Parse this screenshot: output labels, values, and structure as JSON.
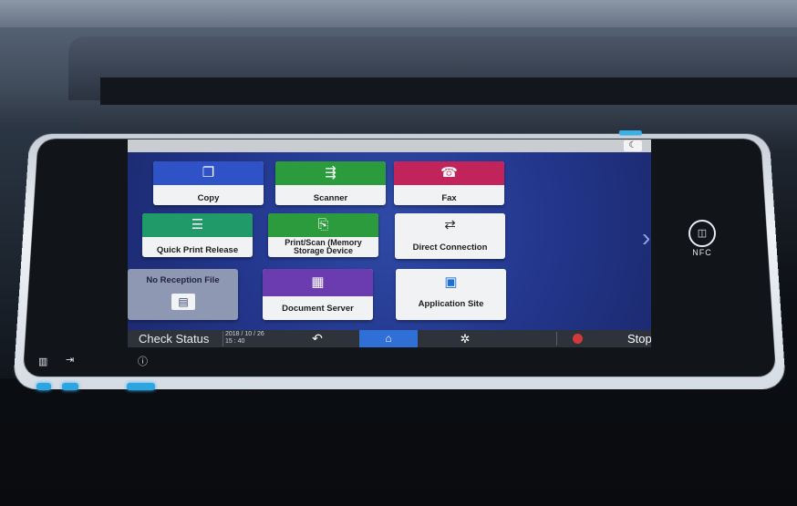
{
  "screen": {
    "tiles": [
      {
        "label": "Copy",
        "color": "#2f52c6",
        "icon": "copy-icon"
      },
      {
        "label": "Scanner",
        "color": "#2c9b3d",
        "icon": "scanner-icon"
      },
      {
        "label": "Fax",
        "color": "#c0245a",
        "icon": "fax-icon"
      },
      {
        "label": "Quick Print Release",
        "color": "#1f9a68",
        "icon": "quick-print-icon"
      },
      {
        "label": "Print/Scan (Memory Storage Device",
        "color": "#2c9b3d",
        "icon": "usb-sd-icon"
      },
      {
        "label": "Direct Connection",
        "icon": "direct-connection-icon"
      },
      {
        "label": "No Reception File",
        "icon": "fax-inbox-icon"
      },
      {
        "label": "Document Server",
        "color": "#6a3cb0",
        "icon": "document-server-icon"
      },
      {
        "label": "Application Site",
        "icon": "application-site-icon"
      }
    ],
    "bottom_bar": {
      "status_label": "Check Status",
      "date": "2018 / 10 / 26",
      "time": "15 : 40",
      "stop_label": "Stop"
    }
  },
  "device": {
    "nfc_label": "NFC"
  }
}
